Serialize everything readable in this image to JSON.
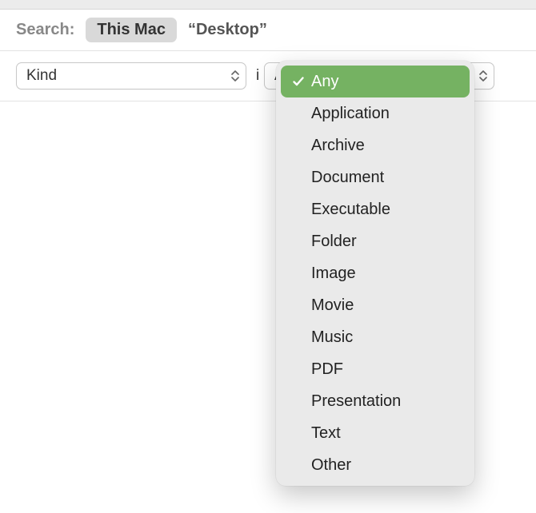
{
  "search": {
    "label": "Search:",
    "scopes": [
      {
        "label": "This Mac",
        "active": true
      },
      {
        "label": "“Desktop”",
        "active": false
      }
    ]
  },
  "criteria": {
    "attribute": "Kind",
    "operator_partial": "i",
    "value": "Any"
  },
  "dropdown": {
    "selected_index": 0,
    "items": [
      "Any",
      "Application",
      "Archive",
      "Document",
      "Executable",
      "Folder",
      "Image",
      "Movie",
      "Music",
      "PDF",
      "Presentation",
      "Text",
      "Other"
    ]
  },
  "colors": {
    "highlight": "#75b262"
  }
}
